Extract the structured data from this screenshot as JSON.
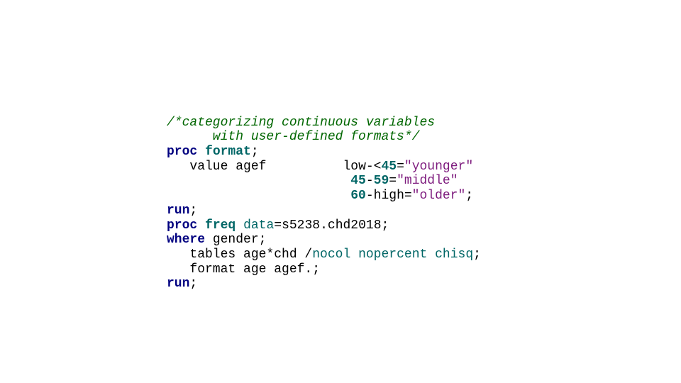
{
  "code": {
    "c1": "/*categorizing continuous variables",
    "c2": "      with user-defined formats*/",
    "proc": "proc",
    "format_proc": "format",
    "semi": ";",
    "value": "   value",
    "agef": " agef",
    "pad1": "          ",
    "low": "low-<",
    "n45": "45",
    "eq": "=",
    "s_younger": "\"younger\"",
    "pad2": "                        ",
    "dash": "-",
    "n59": "59",
    "s_middle": "\"middle\"",
    "n60": "60",
    "dashhigh": "-high=",
    "s_older": "\"older\"",
    "run": "run",
    "freq": "freq",
    "sp": " ",
    "data_eq": "data",
    "eq2": "=s5238.chd2018;",
    "where": "where",
    "gender": " gender;",
    "tables": "   tables",
    "agechd": " age*chd /",
    "nocol": "nocol",
    "nopercent": "nopercent",
    "chisq": "chisq",
    "format_stmt": "   format",
    "age_agef": " age agef.;"
  }
}
